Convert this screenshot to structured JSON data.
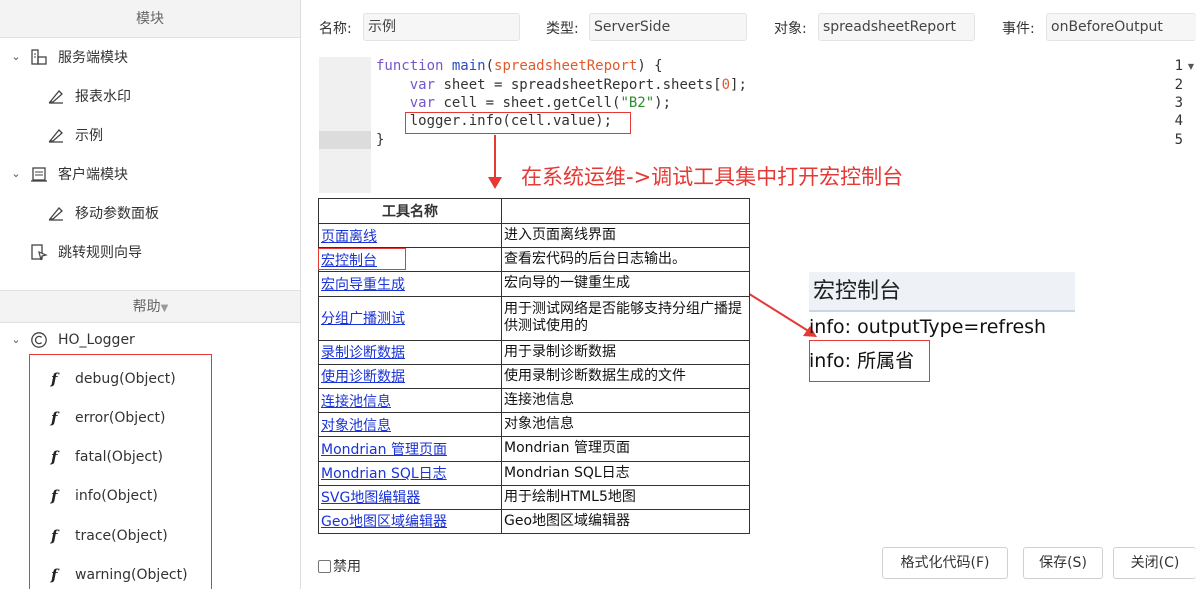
{
  "sidebar": {
    "modules_header": "模块",
    "items": [
      {
        "label": "服务端模块"
      },
      {
        "label": "报表水印"
      },
      {
        "label": "示例"
      },
      {
        "label": "客户端模块"
      },
      {
        "label": "移动参数面板"
      },
      {
        "label": "跳转规则向导"
      }
    ],
    "help_header": "帮助",
    "help_root": "HO_Logger",
    "functions": [
      "debug(Object)",
      "error(Object)",
      "fatal(Object)",
      "info(Object)",
      "trace(Object)",
      "warning(Object)"
    ]
  },
  "form": {
    "name_label": "名称:",
    "name_value": "示例",
    "type_label": "类型:",
    "type_value": "ServerSide",
    "object_label": "对象:",
    "object_value": "spreadsheetReport",
    "event_label": "事件:",
    "event_value": "onBeforeOutput"
  },
  "editor": {
    "line_numbers": [
      "1",
      "2",
      "3",
      "4",
      "5"
    ],
    "lines": [
      "function main(spreadsheetReport) {",
      "    var sheet = spreadsheetReport.sheets[0];",
      "    var cell = sheet.getCell(\"B2\");",
      "    logger.info(cell.value);",
      "}"
    ]
  },
  "annotation": "在系统运维->调试工具集中打开宏控制台",
  "tools_table": {
    "header_name": "工具名称",
    "header_desc": "",
    "rows": [
      {
        "name": "页面离线",
        "desc": "进入页面离线界面"
      },
      {
        "name": "宏控制台",
        "desc": "查看宏代码的后台日志输出。"
      },
      {
        "name": "宏向导重生成",
        "desc": "宏向导的一键重生成"
      },
      {
        "name": "分组广播测试",
        "desc": "用于测试网络是否能够支持分组广播提供测试使用的"
      },
      {
        "name": "录制诊断数据",
        "desc": "用于录制诊断数据"
      },
      {
        "name": "使用诊断数据",
        "desc": "使用录制诊断数据生成的文件"
      },
      {
        "name": "连接池信息",
        "desc": "连接池信息"
      },
      {
        "name": "对象池信息",
        "desc": "对象池信息"
      },
      {
        "name": "Mondrian 管理页面",
        "desc": "Mondrian 管理页面"
      },
      {
        "name": "Mondrian SQL日志",
        "desc": "Mondrian SQL日志"
      },
      {
        "name": "SVG地图编辑器",
        "desc": "用于绘制HTML5地图"
      },
      {
        "name": "Geo地图区域编辑器",
        "desc": "Geo地图区域编辑器"
      }
    ]
  },
  "console": {
    "title": "宏控制台",
    "lines": [
      "info: outputType=refresh",
      "info: 所属省"
    ]
  },
  "footer": {
    "disable_label": "禁用",
    "format_button": "格式化代码(F)",
    "save_button": "保存(S)",
    "close_button": "关闭(C)"
  },
  "colors": {
    "highlight": "#e53935",
    "link": "#1a33d6",
    "keyword": "#7755cc"
  }
}
